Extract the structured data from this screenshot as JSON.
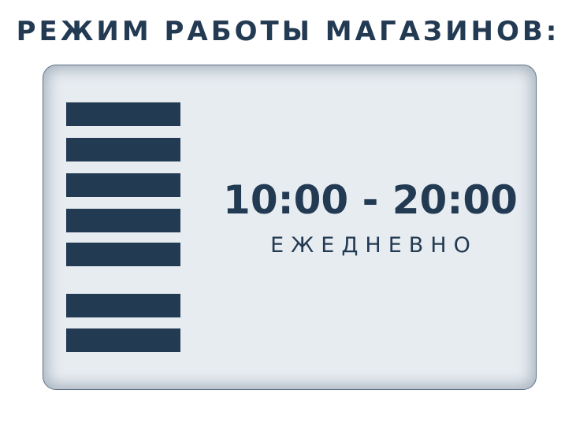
{
  "title": "РЕЖИМ РАБОТЫ МАГАЗИНОВ:",
  "card": {
    "hours": "10:00 - 20:00",
    "schedule": "ЕЖЕДНЕВНО",
    "weekday_bars": 7
  },
  "colors": {
    "primary": "#233a53",
    "card_background": "#e7ecf1",
    "page_background": "#ffffff"
  }
}
